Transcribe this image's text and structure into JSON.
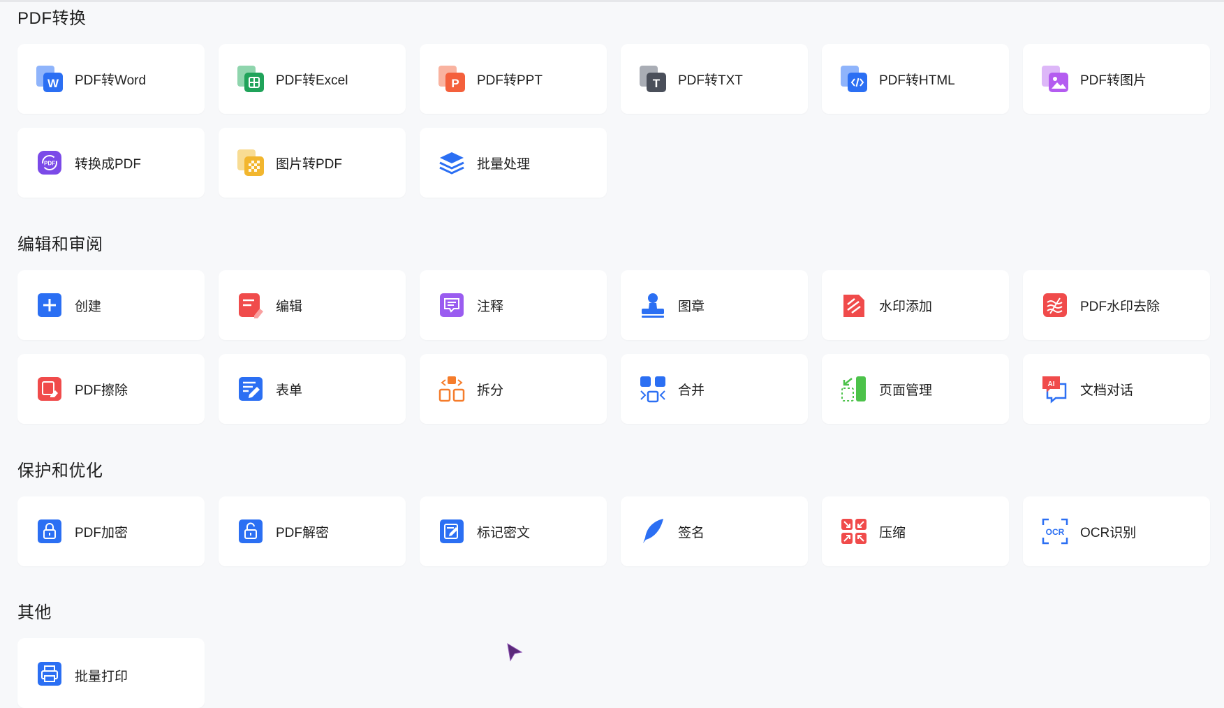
{
  "sections": [
    {
      "title": "PDF转换",
      "items": [
        {
          "label": "PDF转Word",
          "icon": "word-icon",
          "color": "#2b6ff3"
        },
        {
          "label": "PDF转Excel",
          "icon": "excel-icon",
          "color": "#20a35a"
        },
        {
          "label": "PDF转PPT",
          "icon": "ppt-icon",
          "color": "#f4603c"
        },
        {
          "label": "PDF转TXT",
          "icon": "txt-icon",
          "color": "#4a4f5a"
        },
        {
          "label": "PDF转HTML",
          "icon": "html-icon",
          "color": "#2b6ff3"
        },
        {
          "label": "PDF转图片",
          "icon": "image-icon",
          "color": "#b45cf0"
        },
        {
          "label": "转换成PDF",
          "icon": "convert-to-pdf-icon",
          "color": "#7b4ae8"
        },
        {
          "label": "图片转PDF",
          "icon": "image-to-pdf-icon",
          "color": "#f2b62e"
        },
        {
          "label": "批量处理",
          "icon": "layers-icon",
          "color": "#2b6ff3"
        }
      ]
    },
    {
      "title": "编辑和审阅",
      "items": [
        {
          "label": "创建",
          "icon": "plus-icon",
          "color": "#2b6ff3"
        },
        {
          "label": "编辑",
          "icon": "edit-icon",
          "color": "#f04b4b"
        },
        {
          "label": "注释",
          "icon": "comment-icon",
          "color": "#9a5cf0"
        },
        {
          "label": "图章",
          "icon": "stamp-icon",
          "color": "#2b6ff3"
        },
        {
          "label": "水印添加",
          "icon": "watermark-add-icon",
          "color": "#f04b4b"
        },
        {
          "label": "PDF水印去除",
          "icon": "watermark-remove-icon",
          "color": "#f04b4b"
        },
        {
          "label": "PDF擦除",
          "icon": "eraser-icon",
          "color": "#f04b4b"
        },
        {
          "label": "表单",
          "icon": "form-icon",
          "color": "#2b6ff3"
        },
        {
          "label": "拆分",
          "icon": "split-icon",
          "color": "#f57c2b"
        },
        {
          "label": "合并",
          "icon": "merge-icon",
          "color": "#2b6ff3"
        },
        {
          "label": "页面管理",
          "icon": "page-manage-icon",
          "color": "#4cc24a"
        },
        {
          "label": "文档对话",
          "icon": "ai-chat-icon",
          "color": "#f04b4b"
        }
      ]
    },
    {
      "title": "保护和优化",
      "items": [
        {
          "label": "PDF加密",
          "icon": "lock-icon",
          "color": "#2b6ff3"
        },
        {
          "label": "PDF解密",
          "icon": "unlock-icon",
          "color": "#2b6ff3"
        },
        {
          "label": "标记密文",
          "icon": "redact-icon",
          "color": "#2b6ff3"
        },
        {
          "label": "签名",
          "icon": "signature-icon",
          "color": "#2b6ff3"
        },
        {
          "label": "压缩",
          "icon": "compress-icon",
          "color": "#f04b4b"
        },
        {
          "label": "OCR识别",
          "icon": "ocr-icon",
          "color": "#2b6ff3"
        }
      ]
    },
    {
      "title": "其他",
      "items": [
        {
          "label": "批量打印",
          "icon": "print-icon",
          "color": "#2b6ff3"
        }
      ]
    }
  ]
}
